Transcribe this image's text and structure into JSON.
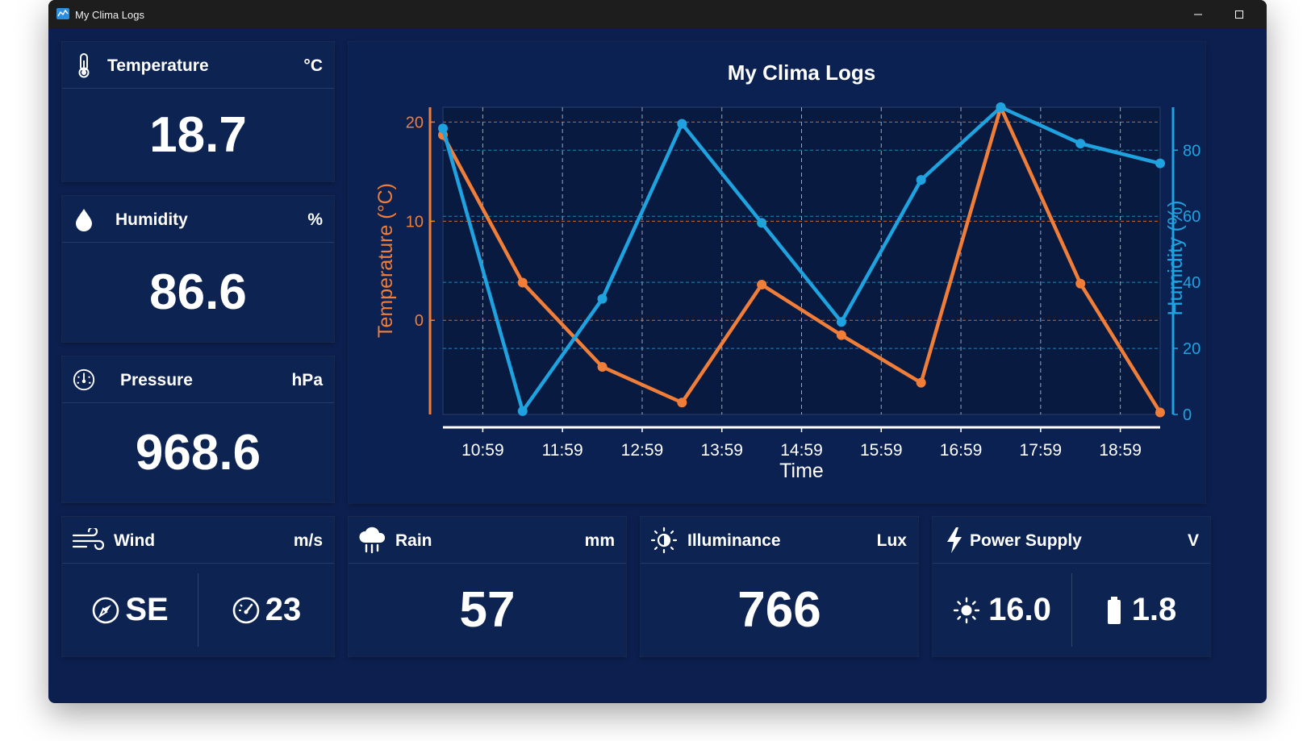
{
  "window": {
    "title": "My Clima Logs"
  },
  "colors": {
    "temperature": "#f07e39",
    "humidity": "#1ea3e0",
    "background": "#0c1f4e"
  },
  "temperature": {
    "label": "Temperature",
    "unit": "°C",
    "value": "18.7",
    "icon": "thermometer-icon"
  },
  "humidity": {
    "label": "Humidity",
    "unit": "%",
    "value": "86.6",
    "icon": "water-drop-icon"
  },
  "pressure": {
    "label": "Pressure",
    "unit": "hPa",
    "value": "968.6",
    "icon": "gauge-icon"
  },
  "wind": {
    "label": "Wind",
    "unit": "m/s",
    "direction": "SE",
    "speed": "23",
    "icon": "wind-icon"
  },
  "rain": {
    "label": "Rain",
    "unit": "mm",
    "value": "57",
    "icon": "rain-cloud-icon"
  },
  "illuminance": {
    "label": "Illuminance",
    "unit": "Lux",
    "value": "766",
    "icon": "illuminance-icon"
  },
  "power": {
    "label": "Power Supply",
    "unit": "V",
    "solar": "16.0",
    "battery": "1.8",
    "icon": "lightning-icon"
  },
  "chart_data": {
    "type": "line",
    "title": "My Clima Logs",
    "xlabel": "Time",
    "ylabel_left": "Temperature (°C)",
    "ylabel_right": "Humidity (%)",
    "x_tick_labels": [
      "10:59",
      "11:59",
      "12:59",
      "13:59",
      "14:59",
      "15:59",
      "16:59",
      "17:59",
      "18:59"
    ],
    "y_left_ticks": [
      "20",
      "10",
      "0"
    ],
    "y_right_ticks": [
      "80",
      "60",
      "40",
      "20",
      "0"
    ],
    "x": [
      "10:29",
      "11:29",
      "12:29",
      "13:29",
      "14:29",
      "15:29",
      "16:29",
      "17:29",
      "18:29",
      "19:29"
    ],
    "x_range": [
      "10:29",
      "19:29"
    ],
    "y_left_range": [
      -9.5,
      21.5
    ],
    "y_right_range": [
      0,
      93
    ],
    "grid": true,
    "series": [
      {
        "name": "Temperature (°C)",
        "axis": "left",
        "color": "#f07e39",
        "values": [
          18.7,
          3.8,
          -4.7,
          -8.3,
          3.6,
          -1.5,
          -6.3,
          21.5,
          3.7,
          -9.3
        ]
      },
      {
        "name": "Humidity (%)",
        "axis": "right",
        "color": "#1ea3e0",
        "values": [
          86.6,
          1,
          35,
          88,
          58,
          28,
          71,
          93,
          82,
          76
        ]
      }
    ]
  }
}
